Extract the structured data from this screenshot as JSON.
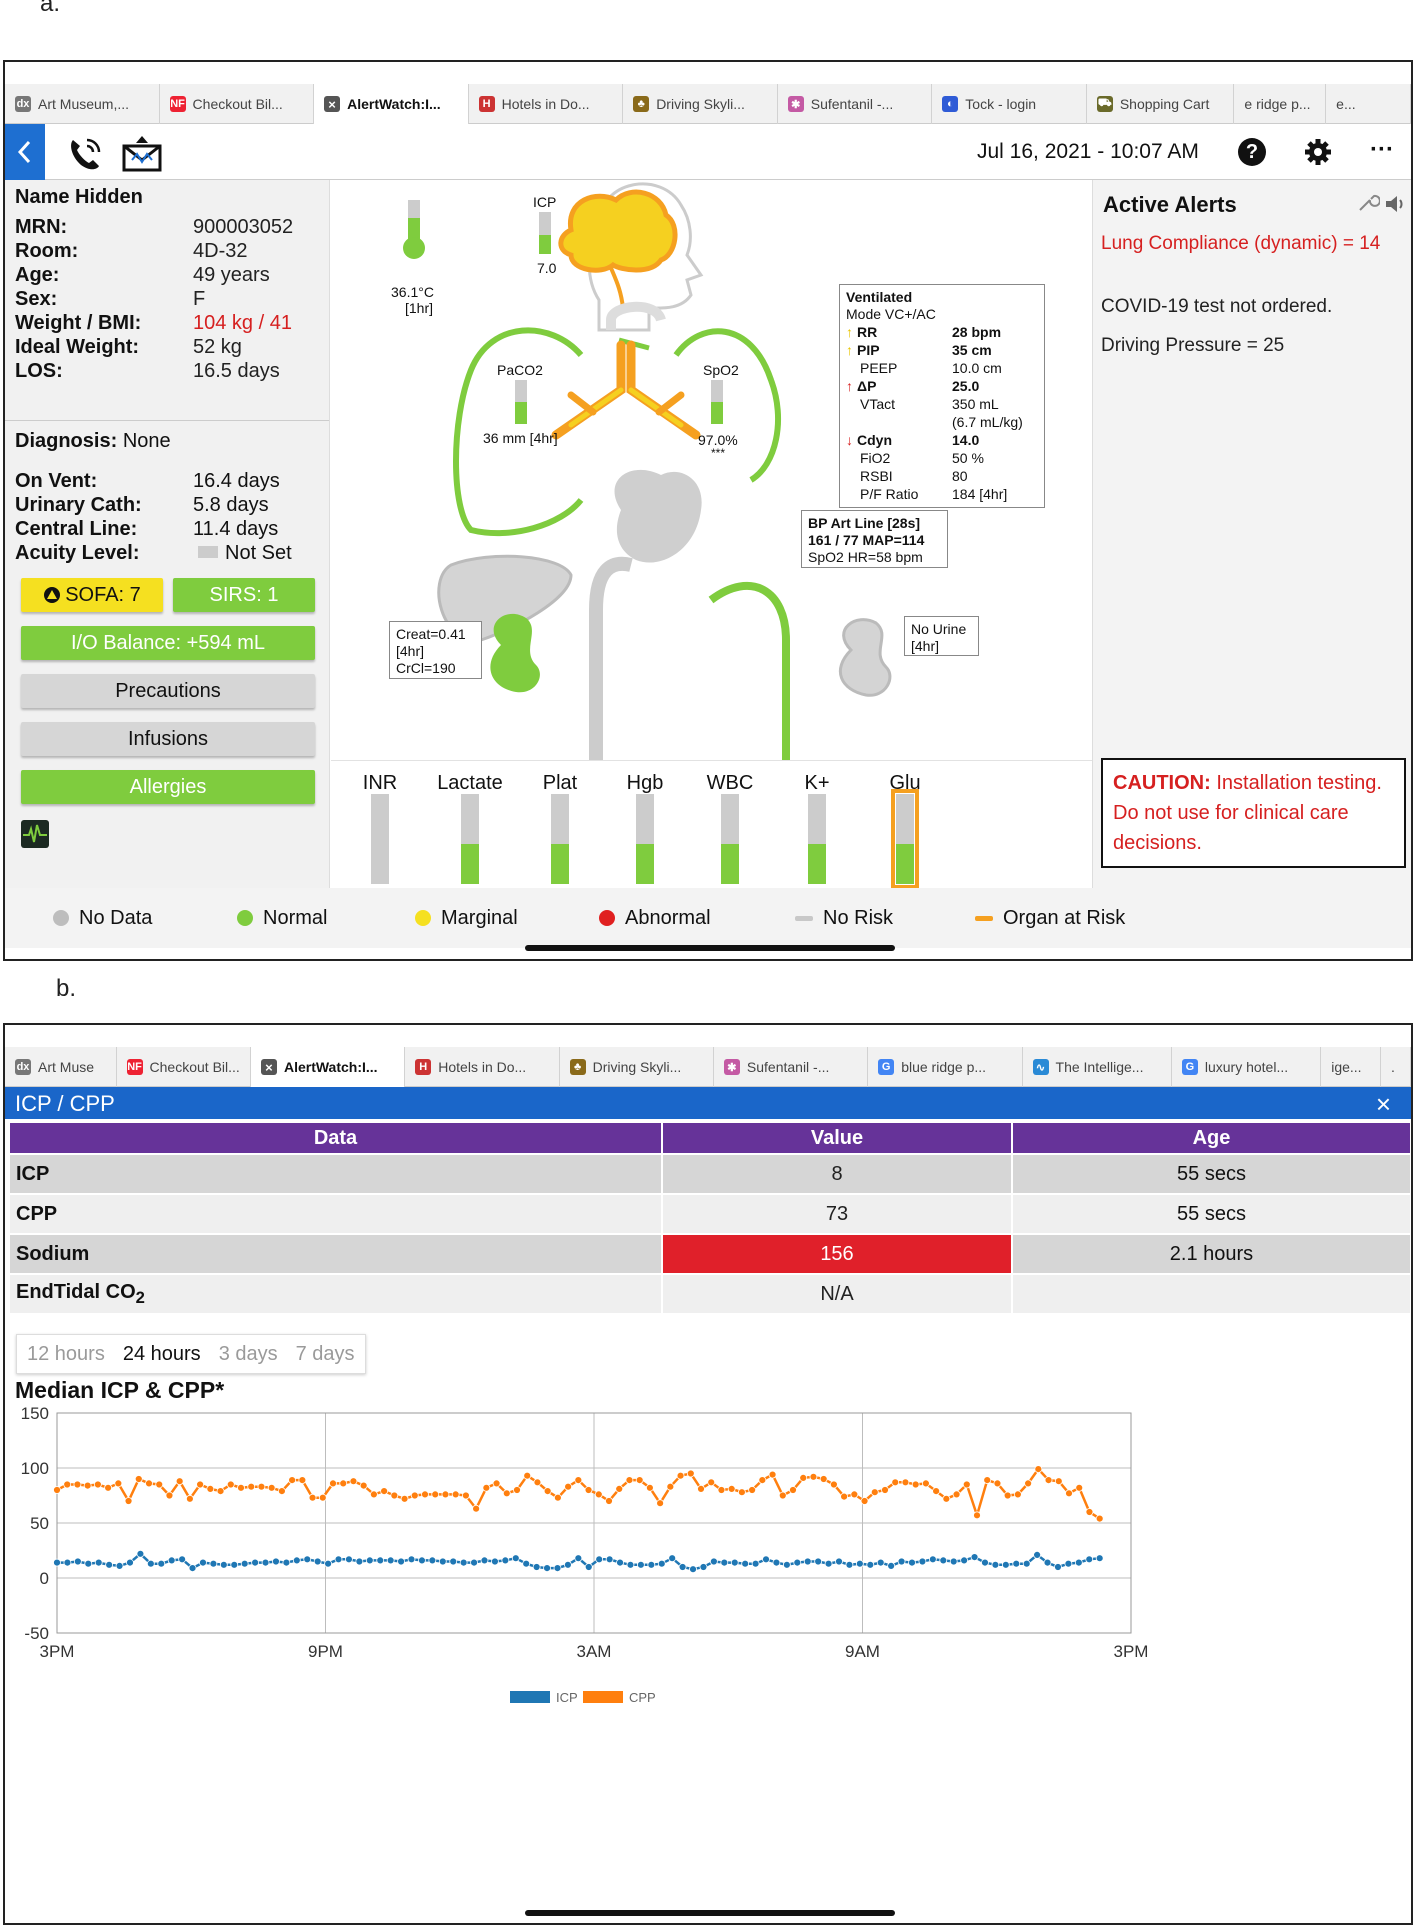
{
  "panel_a": {
    "label": "a.",
    "tabs": [
      {
        "label": "Art Museum,...",
        "icon": "dx-icon",
        "active": false
      },
      {
        "label": "Checkout Bil...",
        "icon": "nf-icon",
        "active": false
      },
      {
        "label": "AlertWatch:I...",
        "icon": "close-icon",
        "active": true
      },
      {
        "label": "Hotels in Do...",
        "icon": "hotel-icon",
        "active": false
      },
      {
        "label": "Driving Skyli...",
        "icon": "park-icon",
        "active": false
      },
      {
        "label": "Sufentanil -...",
        "icon": "molecule-icon",
        "active": false
      },
      {
        "label": "Tock - login",
        "icon": "tock-icon",
        "active": false
      },
      {
        "label": "Shopping Cart",
        "icon": "cart-icon",
        "active": false
      },
      {
        "label": "e ridge p...",
        "icon": "",
        "active": false
      },
      {
        "label": "e...",
        "icon": "",
        "active": false
      }
    ],
    "datetime": "Jul 16, 2021 - 10:07 AM",
    "patient": {
      "name": "Name Hidden",
      "rows": [
        {
          "key": "MRN:",
          "value": "900003052",
          "alert": false
        },
        {
          "key": "Room:",
          "value": "4D-32",
          "alert": false
        },
        {
          "key": "Age:",
          "value": "49 years",
          "alert": false
        },
        {
          "key": "Sex:",
          "value": "F",
          "alert": false
        },
        {
          "key": "Weight / BMI:",
          "value": "104 kg / 41",
          "alert": true
        },
        {
          "key": "Ideal Weight:",
          "value": "52 kg",
          "alert": false
        },
        {
          "key": "LOS:",
          "value": "16.5 days",
          "alert": false
        }
      ],
      "diagnosis_key": "Diagnosis:",
      "diagnosis_value": "None",
      "rows2": [
        {
          "key": "On Vent:",
          "value": "16.4 days"
        },
        {
          "key": "Urinary Cath:",
          "value": "5.8 days"
        },
        {
          "key": "Central Line:",
          "value": "11.4 days"
        },
        {
          "key": "Acuity Level:",
          "value": "Not Set"
        }
      ]
    },
    "buttons": {
      "sofa": "SOFA: 7",
      "sirs": "SIRS: 1",
      "io": "I/O Balance: +594 mL",
      "precautions": "Precautions",
      "infusions": "Infusions",
      "allergies": "Allergies"
    },
    "body": {
      "temp_value": "36.1°C",
      "temp_age": "[1hr]",
      "icp_label": "ICP",
      "icp_value": "7.0",
      "paco2_label": "PaCO2",
      "paco2_value": "36 mm [4hr]",
      "spo2_label": "SpO2",
      "spo2_value": "97.0%",
      "spo2_note": "***",
      "vent": {
        "title": "Ventilated",
        "mode": "Mode VC+/AC",
        "rows": [
          {
            "key": "RR",
            "value": "28 bpm",
            "bold": true,
            "arrow": "↑",
            "arrow_color": "#e8c400"
          },
          {
            "key": "PIP",
            "value": "35 cm",
            "bold": true,
            "arrow": "↑",
            "arrow_color": "#e8c400"
          },
          {
            "key": "PEEP",
            "value": "10.0 cm",
            "bold": false,
            "arrow": "",
            "arrow_color": ""
          },
          {
            "key": "ΔP",
            "value": "25.0",
            "bold": true,
            "arrow": "↑",
            "arrow_color": "#d62020"
          },
          {
            "key": "VTact",
            "value": "350 mL",
            "bold": false,
            "arrow": "",
            "arrow_color": ""
          },
          {
            "key": "",
            "value": "(6.7 mL/kg)",
            "bold": false,
            "arrow": "",
            "arrow_color": ""
          },
          {
            "key": "Cdyn",
            "value": "14.0",
            "bold": true,
            "arrow": "↓",
            "arrow_color": "#d62020"
          },
          {
            "key": "FiO2",
            "value": "50 %",
            "bold": false,
            "arrow": "",
            "arrow_color": ""
          },
          {
            "key": "RSBI",
            "value": "80",
            "bold": false,
            "arrow": "",
            "arrow_color": ""
          },
          {
            "key": "P/F Ratio",
            "value": "184 [4hr]",
            "bold": false,
            "arrow": "",
            "arrow_color": ""
          }
        ]
      },
      "bp": {
        "line1": "BP Art Line [28s]",
        "line2": "161 / 77 MAP=114",
        "line3": "SpO2 HR=58 bpm"
      },
      "renal_left": {
        "line1": "Creat=0.41",
        "line2": "[4hr]",
        "line3": "CrCl=190"
      },
      "renal_right": {
        "line1": "No Urine",
        "line2": "[4hr]"
      }
    },
    "labs": [
      {
        "name": "INR",
        "level": 0,
        "at_risk": false
      },
      {
        "name": "Lactate",
        "level": 0.45,
        "at_risk": false
      },
      {
        "name": "Plat",
        "level": 0.45,
        "at_risk": false
      },
      {
        "name": "Hgb",
        "level": 0.45,
        "at_risk": false
      },
      {
        "name": "WBC",
        "level": 0.45,
        "at_risk": false
      },
      {
        "name": "K+",
        "level": 0.45,
        "at_risk": false
      },
      {
        "name": "Glu",
        "level": 0.45,
        "at_risk": true
      }
    ],
    "alerts": {
      "title": "Active Alerts",
      "items": [
        {
          "text": "Lung Compliance (dynamic) = 14",
          "color": "#d62020"
        },
        {
          "text": "COVID-19 test not ordered.",
          "color": "#222"
        },
        {
          "text": "Driving Pressure = 25",
          "color": "#222"
        }
      ],
      "caution_head": "CAUTION:",
      "caution_body": "Installation testing. Do not use for clinical care decisions."
    },
    "legend": [
      {
        "label": "No Data",
        "color": "#bdbdbd",
        "shape": "dot"
      },
      {
        "label": "Normal",
        "color": "#7fcc3e",
        "shape": "dot"
      },
      {
        "label": "Marginal",
        "color": "#f5e020",
        "shape": "dot"
      },
      {
        "label": "Abnormal",
        "color": "#e02020",
        "shape": "dot"
      },
      {
        "label": "No Risk",
        "color": "#c8c8c8",
        "shape": "dash"
      },
      {
        "label": "Organ at Risk",
        "color": "#f5a020",
        "shape": "dash"
      }
    ]
  },
  "panel_b": {
    "label": "b.",
    "tabs": [
      {
        "label": "Art Muse",
        "icon": "dx-icon",
        "active": false
      },
      {
        "label": "Checkout Bil...",
        "icon": "nf-icon",
        "active": false
      },
      {
        "label": "AlertWatch:I...",
        "icon": "close-icon",
        "active": true
      },
      {
        "label": "Hotels in Do...",
        "icon": "hotel-icon",
        "active": false
      },
      {
        "label": "Driving Skyli...",
        "icon": "park-icon",
        "active": false
      },
      {
        "label": "Sufentanil -...",
        "icon": "molecule-icon",
        "active": false
      },
      {
        "label": "blue ridge p...",
        "icon": "google-icon",
        "active": false
      },
      {
        "label": "The Intellige...",
        "icon": "wave-icon",
        "active": false
      },
      {
        "label": "luxury hotel...",
        "icon": "google-icon",
        "active": false
      },
      {
        "label": "ige...",
        "icon": "",
        "active": false
      },
      {
        "label": ".",
        "icon": "",
        "active": false
      }
    ],
    "modal_title": "ICP / CPP",
    "table": {
      "headers": [
        "Data",
        "Value",
        "Age"
      ],
      "rows": [
        {
          "data": "ICP",
          "value": "8",
          "age": "55 secs",
          "alert": false
        },
        {
          "data": "CPP",
          "value": "73",
          "age": "55 secs",
          "alert": false
        },
        {
          "data": "Sodium",
          "value": "156",
          "age": "2.1 hours",
          "alert": true
        },
        {
          "data": "EndTidal CO2",
          "value": "N/A",
          "age": "",
          "alert": false
        }
      ]
    },
    "range_tabs": [
      {
        "label": "12 hours",
        "selected": false
      },
      {
        "label": "24 hours",
        "selected": true
      },
      {
        "label": "3 days",
        "selected": false
      },
      {
        "label": "7 days",
        "selected": false
      }
    ]
  },
  "chart_data": {
    "type": "line",
    "title": "Median ICP & CPP*",
    "x_tick_labels": [
      "3PM",
      "9PM",
      "3AM",
      "9AM",
      "3PM"
    ],
    "y_ticks": [
      150,
      100,
      50,
      0,
      -50
    ],
    "ylim": [
      -50,
      150
    ],
    "x_range_hours": [
      0,
      24
    ],
    "grid": true,
    "legend_position": "bottom-center",
    "series": [
      {
        "name": "ICP",
        "color": "#1f77b4",
        "values": [
          14,
          14,
          15,
          13,
          14,
          12,
          11,
          14,
          22,
          13,
          13,
          16,
          17,
          9,
          14,
          13,
          12,
          12,
          13,
          14,
          14,
          15,
          14,
          16,
          17,
          15,
          13,
          17,
          17,
          15,
          16,
          16,
          16,
          15,
          17,
          16,
          16,
          15,
          15,
          14,
          14,
          16,
          15,
          16,
          18,
          13,
          10,
          9,
          9,
          12,
          18,
          10,
          17,
          17,
          14,
          12,
          12,
          12,
          13,
          18,
          10,
          8,
          10,
          15,
          14,
          14,
          13,
          13,
          17,
          14,
          12,
          14,
          15,
          15,
          13,
          15,
          12,
          13,
          12,
          14,
          11,
          15,
          14,
          15,
          17,
          16,
          15,
          16,
          19,
          14,
          12,
          12,
          13,
          13,
          21,
          14,
          10,
          13,
          14,
          17,
          18
        ]
      },
      {
        "name": "CPP",
        "color": "#ff7f0e",
        "values": [
          80,
          85,
          85,
          84,
          85,
          82,
          86,
          70,
          90,
          86,
          85,
          75,
          88,
          72,
          85,
          81,
          79,
          85,
          82,
          83,
          83,
          82,
          79,
          89,
          89,
          73,
          73,
          86,
          86,
          88,
          84,
          76,
          79,
          75,
          72,
          75,
          76,
          76,
          76,
          76,
          75,
          63,
          82,
          86,
          77,
          80,
          93,
          87,
          79,
          73,
          83,
          89,
          80,
          76,
          70,
          81,
          89,
          89,
          82,
          68,
          83,
          93,
          95,
          81,
          87,
          80,
          81,
          78,
          80,
          89,
          94,
          75,
          80,
          91,
          92,
          90,
          85,
          74,
          76,
          70,
          78,
          80,
          87,
          87,
          85,
          86,
          79,
          72,
          76,
          85,
          57,
          89,
          86,
          75,
          76,
          86,
          99,
          89,
          88,
          77,
          82,
          60,
          54
        ]
      }
    ]
  }
}
